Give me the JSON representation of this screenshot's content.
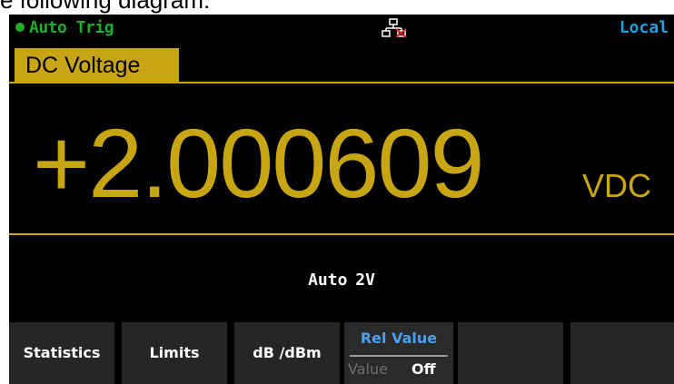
{
  "document": {
    "caption": "e following diagram:"
  },
  "status_bar": {
    "trigger_label": "Auto Trig",
    "trigger_color": "#1fae2a",
    "network_icon": "network-disconnected-icon",
    "remote_label": "Local",
    "remote_color": "#1f9fe0"
  },
  "measurement": {
    "function_label": "DC Voltage",
    "value": "+2.000609",
    "unit": "VDC",
    "range_label": "Auto 2V",
    "accent_color": "#c8a512",
    "function_box_color": "#c7a514"
  },
  "softkeys": {
    "key1_label": "Statistics",
    "key2_label": "Limits",
    "key3_label": "dB /dBm",
    "key4_title": "Rel Value",
    "key4_title_color": "#4a9ff0",
    "key4_option_label": "Value",
    "key4_option_value": "Off",
    "key5_label": "",
    "key6_label": ""
  }
}
